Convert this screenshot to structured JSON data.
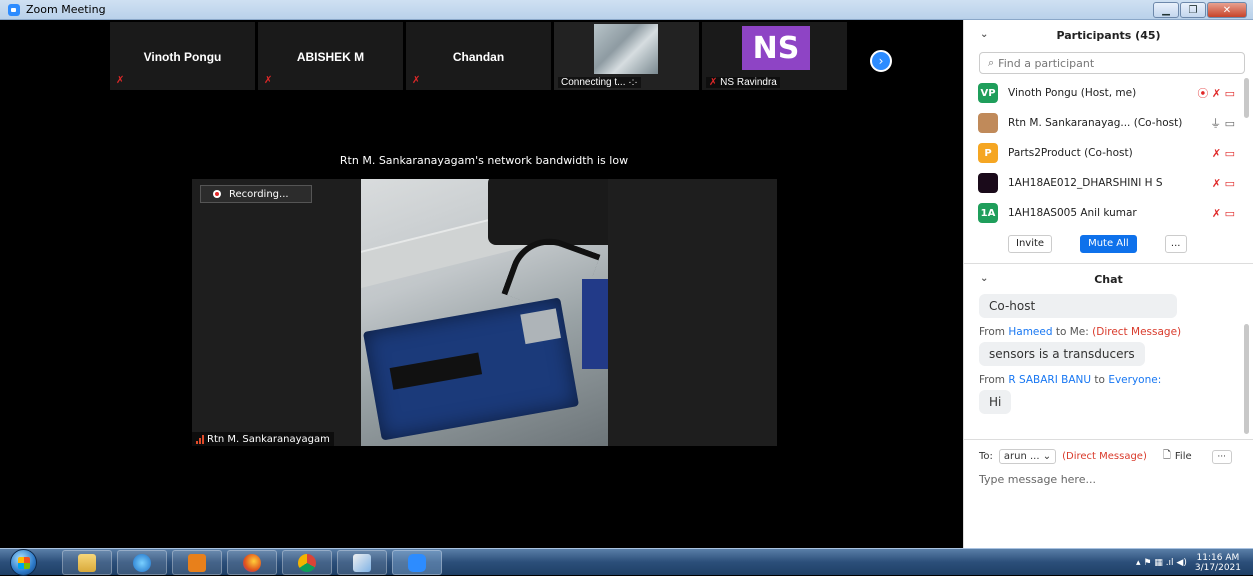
{
  "window": {
    "title": "Zoom Meeting",
    "controls": [
      "minimize",
      "maximize",
      "close"
    ],
    "min_glyph": "▁",
    "max_glyph": "❐",
    "close_glyph": "✕"
  },
  "thumbnails": [
    {
      "name": "Vinoth Pongu"
    },
    {
      "name": "ABISHEK M"
    },
    {
      "name": "Chandan"
    },
    {
      "label": "Connecting t... ·:·"
    },
    {
      "initials": "NS",
      "label": "NS Ravindra"
    }
  ],
  "mute_glyph": "✗",
  "next_glyph": "›",
  "bandwidth_notice": "Rtn M. Sankaranayagam's network bandwidth is low",
  "main_video": {
    "recording_label": "Recording...",
    "speaker_name": "Rtn M. Sankaranayagam"
  },
  "participants": {
    "title": "Participants (45)",
    "chevron": "⌄",
    "search_icon": "⌕",
    "search_placeholder": "Find a participant",
    "list": [
      {
        "avatar": "VP",
        "avatar_color": "#1f9e5b",
        "name": "Vinoth Pongu (Host, me)",
        "icons": "⦿ ✗ ▭"
      },
      {
        "avatar": "",
        "avatar_color": "#c08a5a",
        "name": "Rtn M. Sankaranayag... (Co-host)",
        "icons": "⏚ ▭"
      },
      {
        "avatar": "P",
        "avatar_color": "#f5a623",
        "name": "Parts2Product (Co-host)",
        "icons": "✗ ▭"
      },
      {
        "avatar": "",
        "avatar_color": "#1a0a1a",
        "name": "1AH18AE012_DHARSHINI H S",
        "icons": "✗ ▭"
      },
      {
        "avatar": "1A",
        "avatar_color": "#1f9e5b",
        "name": "1AH18AS005 Anil kumar",
        "icons": "✗ ▭"
      }
    ],
    "invite_label": "Invite",
    "mute_all_label": "Mute All",
    "more_label": "..."
  },
  "chat": {
    "title": "Chat",
    "chevron": "⌄",
    "messages": [
      {
        "text": "Co-host"
      },
      {
        "from_prefix": "From",
        "sender": "Hameed",
        "to_text": "to Me:",
        "dm": "(Direct Message)",
        "text": "sensors is a transducers"
      },
      {
        "from_prefix": "From",
        "sender": "R SABARI BANU",
        "to_text": "to",
        "recipient": "Everyone:",
        "text": "Hi"
      }
    ],
    "composer": {
      "to_label": "To:",
      "to_value": "arun ... ⌄",
      "dm_label": "(Direct Message)",
      "file_icon": "🗋",
      "file_label": "File",
      "more_label": "···",
      "placeholder": "Type message here..."
    }
  },
  "taskbar": {
    "apps": [
      "file-explorer",
      "internet-explorer",
      "outlook",
      "firefox",
      "chrome",
      "paint",
      "zoom"
    ],
    "tray_icons": "▴ ⚑ ▦ .ıl ◀)",
    "time": "11:16 AM",
    "date": "3/17/2021"
  }
}
